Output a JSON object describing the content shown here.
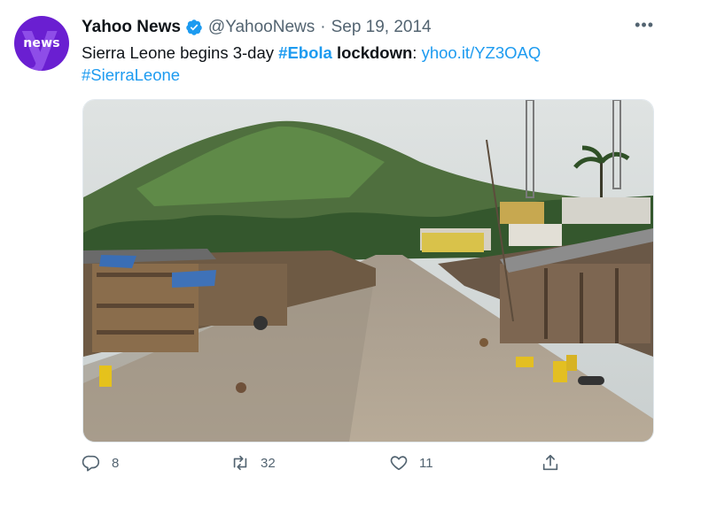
{
  "author": {
    "name": "Yahoo News",
    "handle": "@YahooNews",
    "separator": "·",
    "date": "Sep 19, 2014",
    "avatar_text": "news"
  },
  "tweet": {
    "part1": "Sierra Leone begins 3-day ",
    "hashtag1": "#Ebola",
    "part2": " lockdown",
    "part3": ": ",
    "link": "yhoo.it/YZ3OAQ",
    "hashtag2": "#SierraLeone"
  },
  "actions": {
    "replies": "8",
    "retweets": "32",
    "likes": "11"
  },
  "more_label": "•••",
  "colors": {
    "accent": "#1d9bf0",
    "muted": "#536471",
    "avatar_bg": "#6a1fd1"
  }
}
